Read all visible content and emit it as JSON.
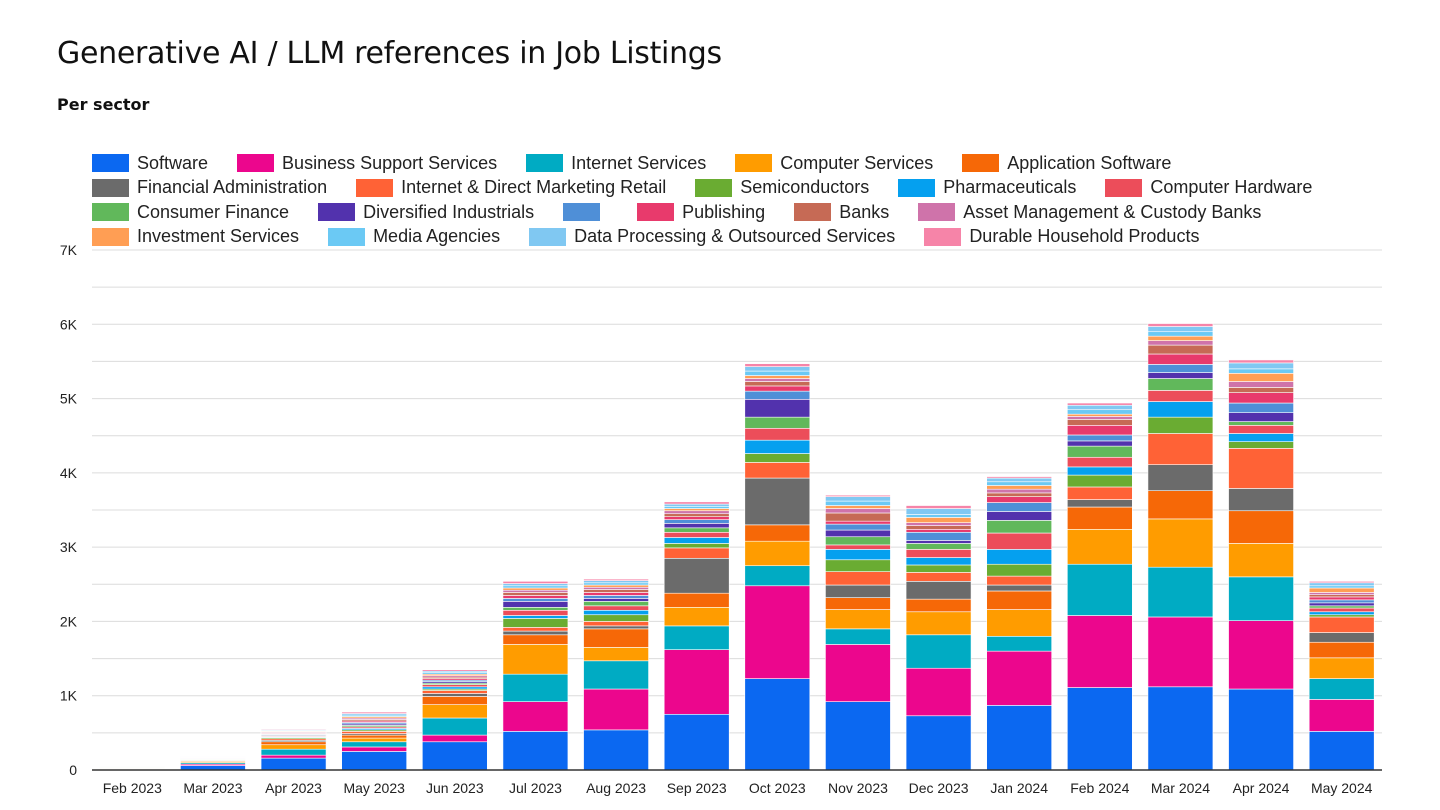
{
  "chart_data": {
    "type": "bar",
    "stacked": true,
    "title": "Generative AI / LLM references in Job Listings",
    "subtitle": "Per sector",
    "xlabel": "",
    "ylabel": "",
    "ylim": [
      0,
      7000
    ],
    "yticks": [
      0,
      1000,
      2000,
      3000,
      4000,
      5000,
      6000,
      7000
    ],
    "ytick_labels": [
      "0",
      "1K",
      "2K",
      "3K",
      "4K",
      "5K",
      "6K",
      "7K"
    ],
    "grid": true,
    "minor_grid_step": 500,
    "legend_position": "top",
    "categories": [
      "Feb 2023",
      "Mar 2023",
      "Apr 2023",
      "May 2023",
      "Jun 2023",
      "Jul 2023",
      "Aug 2023",
      "Sep 2023",
      "Oct 2023",
      "Nov 2023",
      "Dec 2023",
      "Jan 2024",
      "Feb 2024",
      "Mar 2024",
      "Apr 2024",
      "May 2024"
    ],
    "series": [
      {
        "name": "Software",
        "color": "#0b68f1",
        "values": [
          10,
          60,
          160,
          250,
          380,
          520,
          540,
          750,
          1230,
          920,
          730,
          870,
          1110,
          1120,
          1090,
          520
        ]
      },
      {
        "name": "Business Support Services",
        "color": "#ec068d",
        "values": [
          5,
          20,
          40,
          60,
          90,
          400,
          550,
          870,
          1250,
          770,
          640,
          730,
          970,
          940,
          920,
          430
        ]
      },
      {
        "name": "Internet Services",
        "color": "#00abc3",
        "values": [
          5,
          20,
          80,
          70,
          230,
          370,
          380,
          320,
          270,
          210,
          450,
          200,
          690,
          670,
          590,
          280
        ]
      },
      {
        "name": "Computer Services",
        "color": "#ff9c00",
        "values": [
          5,
          15,
          60,
          50,
          180,
          400,
          180,
          250,
          330,
          260,
          310,
          360,
          470,
          650,
          450,
          280
        ]
      },
      {
        "name": "Application Software",
        "color": "#f66807",
        "values": [
          3,
          10,
          40,
          40,
          110,
          130,
          250,
          190,
          220,
          160,
          170,
          250,
          300,
          380,
          440,
          210
        ]
      },
      {
        "name": "Financial Administration",
        "color": "#6b6b6b",
        "values": [
          3,
          10,
          20,
          20,
          40,
          50,
          40,
          470,
          630,
          170,
          240,
          80,
          100,
          350,
          300,
          130
        ]
      },
      {
        "name": "Internet & Direct Marketing Retail",
        "color": "#ff6236",
        "values": [
          2,
          5,
          20,
          30,
          40,
          50,
          60,
          140,
          210,
          180,
          120,
          120,
          170,
          420,
          540,
          210
        ]
      },
      {
        "name": "Semiconductors",
        "color": "#6aac32",
        "values": [
          2,
          5,
          15,
          20,
          20,
          120,
          90,
          60,
          120,
          160,
          100,
          160,
          160,
          220,
          90,
          30
        ]
      },
      {
        "name": "Pharmaceuticals",
        "color": "#05a0ef",
        "values": [
          2,
          5,
          10,
          20,
          30,
          40,
          60,
          80,
          180,
          140,
          100,
          200,
          110,
          210,
          110,
          40
        ]
      },
      {
        "name": "Computer Hardware",
        "color": "#ec4d5a",
        "values": [
          2,
          5,
          10,
          20,
          30,
          70,
          60,
          70,
          160,
          60,
          110,
          220,
          130,
          150,
          110,
          50
        ]
      },
      {
        "name": "Consumer Finance",
        "color": "#61b85b",
        "values": [
          2,
          5,
          10,
          20,
          20,
          40,
          60,
          60,
          150,
          110,
          80,
          170,
          150,
          160,
          50,
          30
        ]
      },
      {
        "name": "Diversified Industrials",
        "color": "#5232ad",
        "values": [
          1,
          3,
          10,
          20,
          20,
          80,
          40,
          60,
          240,
          90,
          40,
          120,
          70,
          80,
          120,
          40
        ]
      },
      {
        "name": "",
        "color": "#4f8fd7",
        "values": [
          1,
          3,
          10,
          20,
          20,
          40,
          40,
          50,
          110,
          80,
          110,
          120,
          80,
          110,
          130,
          40
        ]
      },
      {
        "name": "Publishing",
        "color": "#e83a6c",
        "values": [
          1,
          3,
          10,
          20,
          20,
          40,
          40,
          40,
          70,
          40,
          40,
          80,
          130,
          140,
          140,
          40
        ]
      },
      {
        "name": "Banks",
        "color": "#c66a55",
        "values": [
          1,
          3,
          10,
          20,
          20,
          40,
          40,
          40,
          60,
          110,
          50,
          50,
          80,
          120,
          70,
          30
        ]
      },
      {
        "name": "Asset Management & Custody Banks",
        "color": "#cf73aa",
        "values": [
          1,
          3,
          10,
          20,
          20,
          30,
          30,
          40,
          40,
          60,
          40,
          50,
          40,
          60,
          80,
          30
        ]
      },
      {
        "name": "Investment Services",
        "color": "#ff9e54",
        "values": [
          1,
          3,
          10,
          20,
          20,
          30,
          30,
          30,
          40,
          40,
          70,
          50,
          30,
          60,
          110,
          60
        ]
      },
      {
        "name": "Media Agencies",
        "color": "#6bc9f4",
        "values": [
          1,
          3,
          10,
          20,
          20,
          30,
          30,
          30,
          60,
          60,
          40,
          50,
          60,
          60,
          60,
          30
        ]
      },
      {
        "name": "Data Processing & Outsourced Services",
        "color": "#80c8f2",
        "values": [
          1,
          3,
          10,
          20,
          20,
          30,
          30,
          30,
          60,
          60,
          80,
          50,
          60,
          70,
          80,
          40
        ]
      },
      {
        "name": "Durable Household Products",
        "color": "#f684a8",
        "values": [
          1,
          3,
          10,
          20,
          20,
          30,
          20,
          30,
          40,
          20,
          40,
          20,
          30,
          40,
          40,
          20
        ]
      }
    ]
  },
  "legend_rows": [
    [
      0,
      1,
      2,
      3,
      4
    ],
    [
      5,
      6,
      7,
      8,
      9
    ],
    [
      10,
      11,
      12,
      13,
      14,
      15
    ],
    [
      16,
      17,
      18,
      19
    ]
  ]
}
